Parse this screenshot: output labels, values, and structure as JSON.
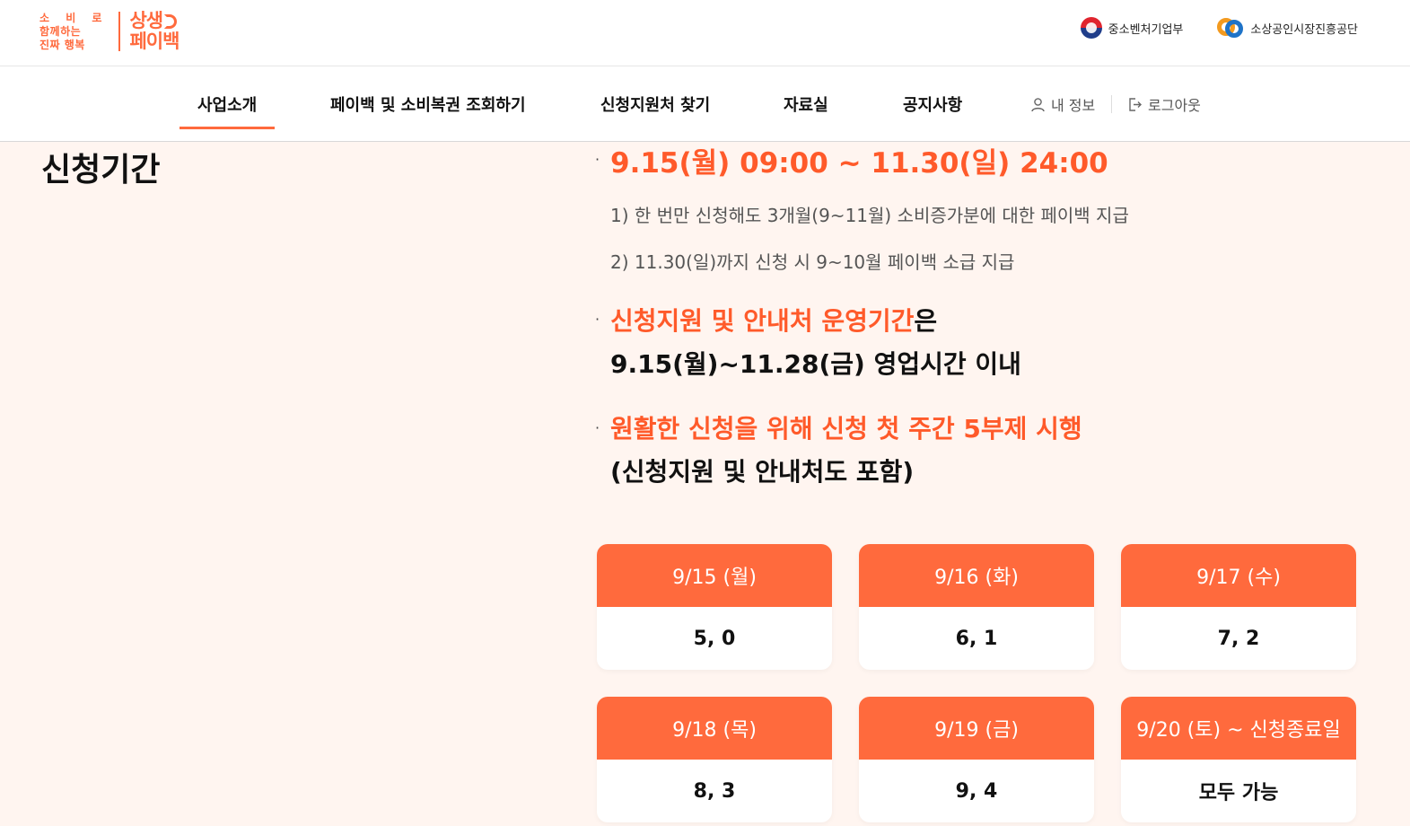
{
  "header": {
    "logo": {
      "small_lines": [
        "소 비 로",
        "함께하는",
        "진짜 행복"
      ],
      "big_lines": [
        "상생",
        "페이백"
      ]
    },
    "orgs": [
      {
        "icon": "taegeuk-emblem-icon",
        "label": "중소벤처기업부"
      },
      {
        "icon": "semas-logo-icon",
        "label": "소상공인시장진흥공단"
      }
    ]
  },
  "nav": {
    "items": [
      {
        "label": "사업소개",
        "active": true
      },
      {
        "label": "페이백 및 소비복권 조회하기",
        "active": false
      },
      {
        "label": "신청지원처 찾기",
        "active": false
      },
      {
        "label": "자료실",
        "active": false
      },
      {
        "label": "공지사항",
        "active": false
      }
    ],
    "my_info": "내 정보",
    "logout": "로그아웃"
  },
  "content": {
    "title": "신청기간",
    "period": "9.15(월) 09:00 ~ 11.30(일) 24:00",
    "notes": [
      "1) 한 번만 신청해도 3개월(9~11월) 소비증가분에 대한 페이백 지급",
      "2) 11.30(일)까지 신청 시 9~10월 페이백 소급 지급"
    ],
    "support_highlight": "신청지원 및 안내처 운영기간",
    "support_suffix": "은",
    "support_line2": "9.15(월)~11.28(금) 영업시간 이내",
    "fivepart_highlight": "원활한 신청을 위해 신청 첫 주간 5부제 시행",
    "fivepart_line2": "(신청지원 및 안내처도 포함)",
    "bullet": "·"
  },
  "schedule": [
    {
      "date": "9/15 (월)",
      "digits": "5, 0"
    },
    {
      "date": "9/16 (화)",
      "digits": "6, 1"
    },
    {
      "date": "9/17 (수)",
      "digits": "7, 2"
    },
    {
      "date": "9/18 (목)",
      "digits": "8, 3"
    },
    {
      "date": "9/19 (금)",
      "digits": "9, 4"
    },
    {
      "date": "9/20 (토) ~ 신청종료일",
      "digits": "모두 가능"
    }
  ],
  "colors": {
    "accent": "#ff6a3d",
    "background": "#fff5f0"
  }
}
